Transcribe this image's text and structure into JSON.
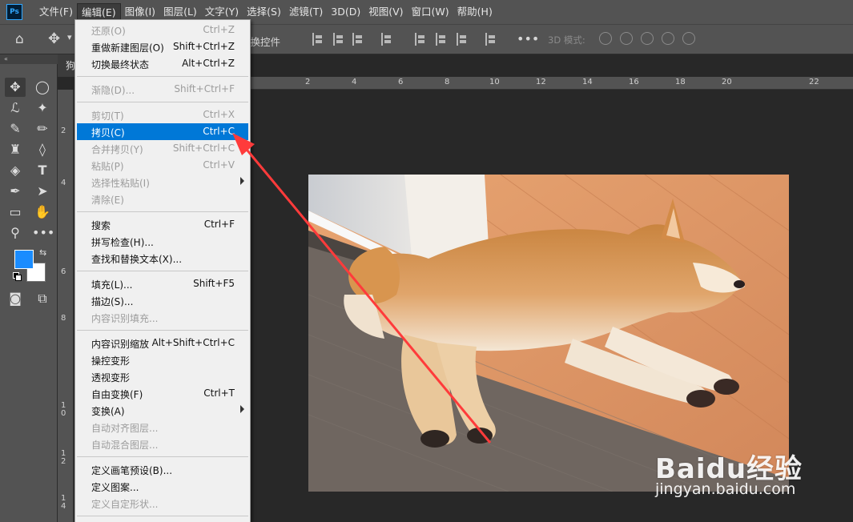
{
  "app": {
    "logo_text": "Ps"
  },
  "menubar": {
    "items": [
      "文件(F)",
      "编辑(E)",
      "图像(I)",
      "图层(L)",
      "文字(Y)",
      "选择(S)",
      "滤镜(T)",
      "3D(D)",
      "视图(V)",
      "窗口(W)",
      "帮助(H)"
    ],
    "active_index": 1
  },
  "optionsbar": {
    "transform_controls_label": "变换控件",
    "mode_3d_label": "3D 模式:",
    "more_icon": "ellipsis-icon"
  },
  "document": {
    "tab_title": "狗"
  },
  "rulers": {
    "top": [
      "2",
      "4",
      "6",
      "8",
      "10",
      "12",
      "14",
      "16",
      "18",
      "20",
      "22"
    ],
    "left": [
      "2",
      "4",
      "6",
      "8",
      "1\n0",
      "1\n2",
      "1\n4"
    ]
  },
  "edit_menu": {
    "items": [
      {
        "label": "还原(O)",
        "shortcut": "Ctrl+Z",
        "disabled": true
      },
      {
        "label": "重做新建图层(O)",
        "shortcut": "Shift+Ctrl+Z",
        "disabled": false
      },
      {
        "label": "切换最终状态",
        "shortcut": "Alt+Ctrl+Z",
        "disabled": false
      },
      {
        "label": "渐隐(D)...",
        "shortcut": "Shift+Ctrl+F",
        "disabled": true
      },
      {
        "label": "剪切(T)",
        "shortcut": "Ctrl+X",
        "disabled": true
      },
      {
        "label": "拷贝(C)",
        "shortcut": "Ctrl+C",
        "disabled": false,
        "highlighted": true
      },
      {
        "label": "合并拷贝(Y)",
        "shortcut": "Shift+Ctrl+C",
        "disabled": true
      },
      {
        "label": "粘贴(P)",
        "shortcut": "Ctrl+V",
        "disabled": true
      },
      {
        "label": "选择性粘贴(I)",
        "shortcut": "",
        "disabled": true,
        "submenu": true
      },
      {
        "label": "清除(E)",
        "shortcut": "",
        "disabled": true
      },
      {
        "label": "搜索",
        "shortcut": "Ctrl+F",
        "disabled": false
      },
      {
        "label": "拼写检查(H)...",
        "shortcut": "",
        "disabled": false
      },
      {
        "label": "查找和替换文本(X)...",
        "shortcut": "",
        "disabled": false
      },
      {
        "label": "填充(L)...",
        "shortcut": "Shift+F5",
        "disabled": false
      },
      {
        "label": "描边(S)...",
        "shortcut": "",
        "disabled": false
      },
      {
        "label": "内容识别填充...",
        "shortcut": "",
        "disabled": true
      },
      {
        "label": "内容识别缩放",
        "shortcut": "Alt+Shift+Ctrl+C",
        "disabled": false
      },
      {
        "label": "操控变形",
        "shortcut": "",
        "disabled": false
      },
      {
        "label": "透视变形",
        "shortcut": "",
        "disabled": false
      },
      {
        "label": "自由变换(F)",
        "shortcut": "Ctrl+T",
        "disabled": false
      },
      {
        "label": "变换(A)",
        "shortcut": "",
        "disabled": false,
        "submenu": true
      },
      {
        "label": "自动对齐图层...",
        "shortcut": "",
        "disabled": true
      },
      {
        "label": "自动混合图层...",
        "shortcut": "",
        "disabled": true
      },
      {
        "label": "定义画笔预设(B)...",
        "shortcut": "",
        "disabled": false
      },
      {
        "label": "定义图案...",
        "shortcut": "",
        "disabled": false
      },
      {
        "label": "定义自定形状...",
        "shortcut": "",
        "disabled": true
      }
    ]
  },
  "watermark": {
    "logo": "Baidu经验",
    "url": "jingyan.baidu.com"
  },
  "colors": {
    "foreground": "#1a8cff",
    "background": "#ffffff",
    "menu_highlight": "#0078d7",
    "annotation_arrow": "#ff3b3b"
  }
}
